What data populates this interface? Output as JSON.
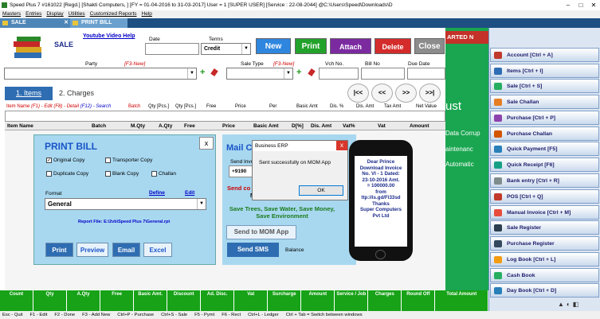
{
  "window": {
    "title": "Speed Plus 7 #161022  [Regd.]  [Shakti Computers, ]  [FY = 01-04-2016 to 31-03-2017]  User = 1 [SUPER USER]  [Service : 22-08-2044]  @C:\\Users\\Speed\\Downloads\\D"
  },
  "menu": [
    "Masters",
    "Entries",
    "Display",
    "Utilities",
    "Customized Reports",
    "Help"
  ],
  "tabs": [
    {
      "label": "SALE"
    },
    {
      "label": "PRINT BILL"
    }
  ],
  "header": {
    "title": "SALE",
    "youtube_link": "Youtube Video Help",
    "date_label": "Date",
    "terms_label": "Terms",
    "terms_value": "Credit",
    "party_label": "Party",
    "party_hint": "[F3-New]",
    "saletype_label": "Sale Type",
    "saletype_hint": "[F3-New]",
    "vchno_label": "Vch No.",
    "billno_label": "Bill No",
    "duedate_label": "Due Date"
  },
  "toolbar": {
    "new": "New",
    "print": "Print",
    "attach": "Attach",
    "delete": "Delete",
    "close": "Close"
  },
  "itemtabs": {
    "items": "1. Items",
    "charges": "2. Charges"
  },
  "nav": [
    "|<<",
    "<<",
    ">>",
    ">>|"
  ],
  "entry_labels": {
    "item_name": "Item Name",
    "hint1": "(F1) - Edit",
    "hint2": "(F8) - Detail",
    "hint3": "(F12) - Search",
    "batch": "Batch",
    "qty_pcs": "Qty [Pcs.]",
    "qty_pcs2": "Qty [Pcs.]",
    "free": "Free",
    "price": "Price",
    "per": "Per",
    "basic_amt": "Basic Amt",
    "dis_pct": "Dis. %",
    "dis_amt": "Dis. Amt",
    "tax_amt": "Tax Amt",
    "net_value": "Net Value"
  },
  "grid_headers": [
    "Item Name",
    "Batch",
    "M.Qty",
    "A.Qty",
    "Free",
    "Price",
    "Basic Amt",
    "D[%]",
    "Dis. Amt",
    "Vat%",
    "Vat",
    "Amount"
  ],
  "totals_bar": [
    "Count",
    "Qty",
    "A.Qty",
    "Free",
    "Basic Amt.",
    "Discount",
    "Ad. Disc.",
    "Vat",
    "Surcharge",
    "Amount",
    "Service / Job",
    "Charges",
    "Round Off",
    "Total Amount"
  ],
  "status": [
    "Esc - Quit",
    "F1 - Edit",
    "F2 - Done",
    "F3 - Add New",
    "Ctrl+P - Purchase",
    "Ctrl+S - Sale",
    "F5 - Pymt",
    "F6 - Rect",
    "Ctrl+L - Ledger",
    "Ctrl + Tab = Switch between windows"
  ],
  "print_bill": {
    "title": "PRINT BILL",
    "close": "x",
    "original_copy": "Original Copy",
    "transporter_copy": "Transporter Copy",
    "duplicate_copy": "Duplicate Copy",
    "blank_copy": "Blank Copy",
    "challan": "Challan",
    "format_label": "Format",
    "define": "Define",
    "edit": "Edit",
    "format_value": "General",
    "report_file": "Report File: E:\\2vb\\Speed Plus 7\\General.rpt",
    "print": "Print",
    "preview": "Preview",
    "email": "Email",
    "excel": "Excel"
  },
  "mail": {
    "title": "Mail C",
    "send_invoice": "Send Invoi",
    "number": "+9190",
    "send_co": "Send co",
    "n": "N",
    "slogan": "Save Trees, Save Water, Save Money, Save Environment",
    "mom_button": "Send to MOM App",
    "sms_button": "Send SMS",
    "balance": "Balance"
  },
  "dialog": {
    "title": "Business ERP",
    "close": "x",
    "message": "Sent successfully on MOM App",
    "ok": "OK"
  },
  "phone": {
    "lines": [
      "Dear Prince",
      "Download Invoice",
      "No. VI - 1 Dated:",
      "23-10-2016 Amt.",
      "= 100000.00",
      "from",
      "ttp://is.gd/Fi33sd",
      "Thanks",
      "Super Computers",
      "Pvt Ltd"
    ]
  },
  "background": {
    "banner": "ARTED N",
    "t1": "ust",
    "t2": "Data Corrup",
    "t3": "aintenanc",
    "t4": "Automatic"
  },
  "sidebar": [
    {
      "label": "Account [Ctrl + A]",
      "color": "#c0392b"
    },
    {
      "label": "Items [Ctrl + I]",
      "color": "#2e6db4"
    },
    {
      "label": "Sale [Ctrl + S]",
      "color": "#27ae60"
    },
    {
      "label": "Sale Challan",
      "color": "#e67e22"
    },
    {
      "label": "Purchase [Ctrl + P]",
      "color": "#8e44ad"
    },
    {
      "label": "Purchase Challan",
      "color": "#d35400"
    },
    {
      "label": "Quick Payment [F5]",
      "color": "#2980b9"
    },
    {
      "label": "Quick Receipt [F6]",
      "color": "#16a085"
    },
    {
      "label": "Bank entry [Ctrl + R]",
      "color": "#7f8c8d"
    },
    {
      "label": "POS [Ctrl + Q]",
      "color": "#c0392b"
    },
    {
      "label": "Manual Invoice [Ctrl + M]",
      "color": "#e74c3c"
    },
    {
      "label": "Sale Register",
      "color": "#2c3e50"
    },
    {
      "label": "Purchase Register",
      "color": "#34495e"
    },
    {
      "label": "Log Book [Ctrl + L]",
      "color": "#f39c12"
    },
    {
      "label": "Cash Book",
      "color": "#27ae60"
    },
    {
      "label": "Day Book [Ctrl + D]",
      "color": "#2980b9"
    }
  ]
}
